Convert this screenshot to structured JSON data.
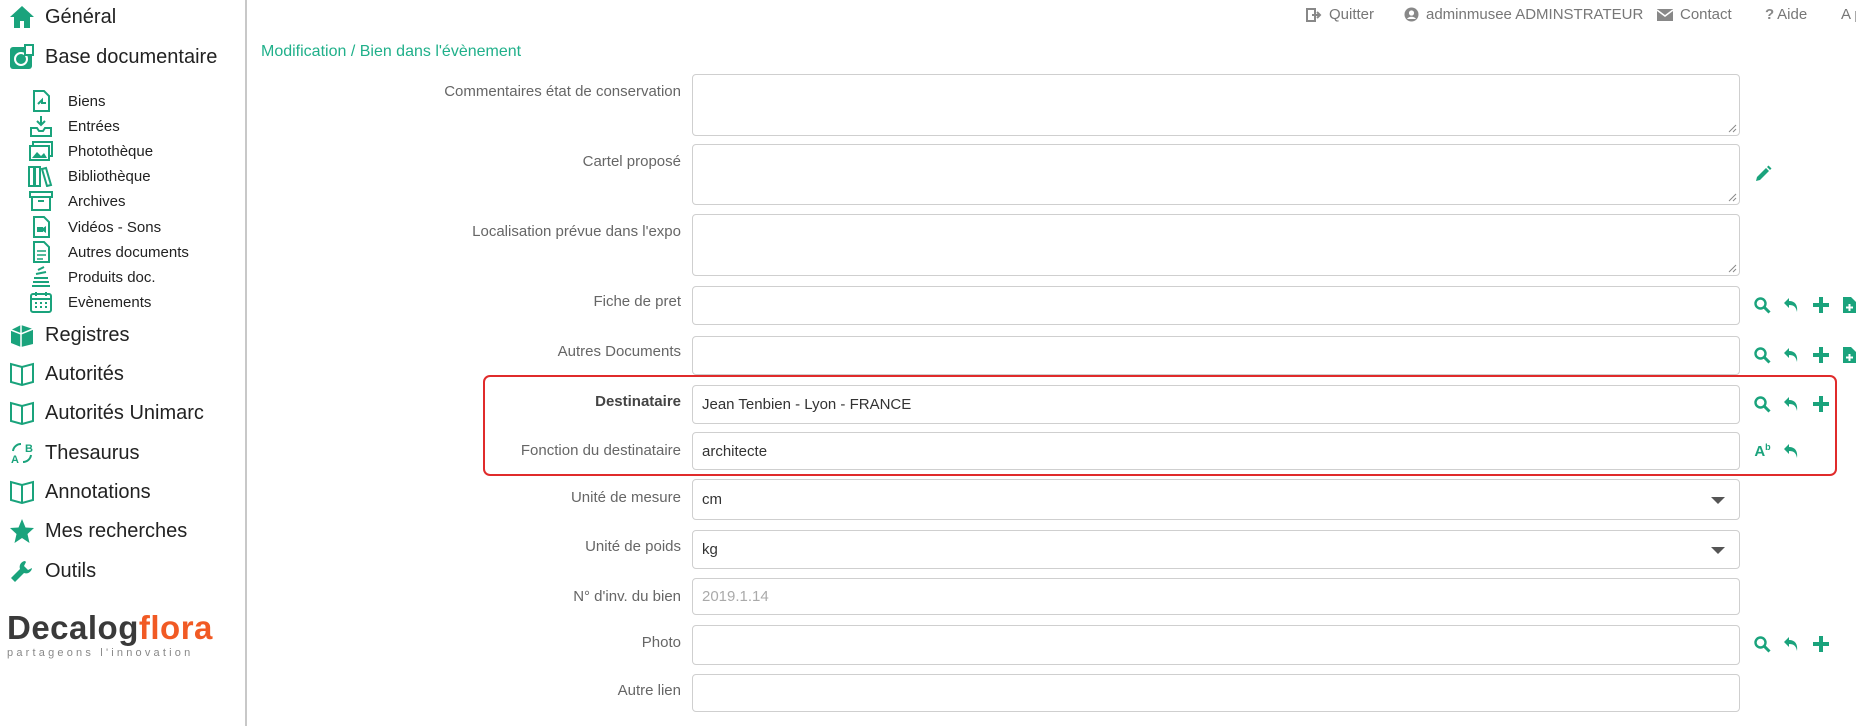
{
  "sidebar": {
    "main_items": [
      {
        "label": "Général",
        "icon": "home-icon"
      },
      {
        "label": "Base documentaire",
        "icon": "documents-icon"
      },
      {
        "label": "Registres",
        "icon": "registers-icon"
      },
      {
        "label": "Autorités",
        "icon": "book-icon"
      },
      {
        "label": "Autorités Unimarc",
        "icon": "book-icon"
      },
      {
        "label": "Thesaurus",
        "icon": "thesaurus-icon"
      },
      {
        "label": "Annotations",
        "icon": "book-icon"
      },
      {
        "label": "Mes recherches",
        "icon": "star-icon"
      },
      {
        "label": "Outils",
        "icon": "wrench-icon"
      }
    ],
    "sub_items": [
      {
        "label": "Biens",
        "icon": "file-arrow-icon"
      },
      {
        "label": "Entrées",
        "icon": "inbox-icon"
      },
      {
        "label": "Photothèque",
        "icon": "images-icon"
      },
      {
        "label": "Bibliothèque",
        "icon": "library-icon"
      },
      {
        "label": "Archives",
        "icon": "archive-icon"
      },
      {
        "label": "Vidéos - Sons",
        "icon": "video-file-icon"
      },
      {
        "label": "Autres documents",
        "icon": "file-text-icon"
      },
      {
        "label": "Produits doc.",
        "icon": "stack-icon"
      },
      {
        "label": "Evènements",
        "icon": "calendar-icon"
      }
    ],
    "logo": {
      "part1": "Decalog",
      "part2": "flora",
      "tagline": "partageons l'innovation"
    }
  },
  "topbar": {
    "quit": "Quitter",
    "user": "adminmusee ADMINSTRATEUR",
    "contact": "Contact",
    "help": "Aide",
    "cut": "A p"
  },
  "breadcrumb": "Modification / Bien dans l'évènement",
  "form": {
    "comments_label": "Commentaires état de conservation",
    "cartel_label": "Cartel proposé",
    "localisation_label": "Localisation prévue dans l'expo",
    "fiche_label": "Fiche de pret",
    "autres_label": "Autres Documents",
    "destinataire_label": "Destinataire",
    "destinataire_value": "Jean Tenbien - Lyon - FRANCE",
    "fonction_label": "Fonction du destinataire",
    "fonction_value": "architecte",
    "unite_mesure_label": "Unité de mesure",
    "unite_mesure_value": "cm",
    "unite_poids_label": "Unité de poids",
    "unite_poids_value": "kg",
    "inv_label": "N° d'inv. du bien",
    "inv_value": "2019.1.14",
    "photo_label": "Photo",
    "autre_lien_label": "Autre lien"
  },
  "colors": {
    "accent": "#1aa37c",
    "highlight": "#e02b2b",
    "brand_orange": "#f15a24"
  }
}
